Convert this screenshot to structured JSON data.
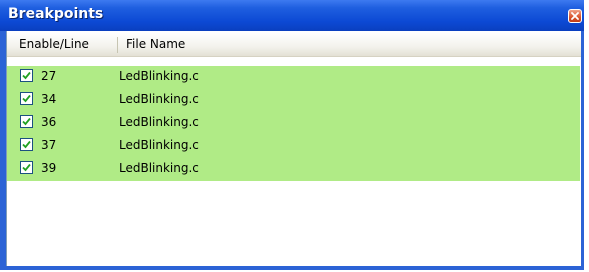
{
  "window": {
    "title": "Breakpoints"
  },
  "columns": {
    "enable_line": "Enable/Line",
    "file_name": "File Name"
  },
  "breakpoints": [
    {
      "enabled": true,
      "line": "27",
      "file": "LedBlinking.c"
    },
    {
      "enabled": true,
      "line": "34",
      "file": "LedBlinking.c"
    },
    {
      "enabled": true,
      "line": "36",
      "file": "LedBlinking.c"
    },
    {
      "enabled": true,
      "line": "37",
      "file": "LedBlinking.c"
    },
    {
      "enabled": true,
      "line": "39",
      "file": "LedBlinking.c"
    }
  ],
  "colors": {
    "titlebar": "#0c49d4",
    "row_highlight": "#b0eb86",
    "close_button": "#d9542e"
  },
  "icons": {
    "close": "close-icon",
    "checkbox": "checkmark-icon"
  }
}
